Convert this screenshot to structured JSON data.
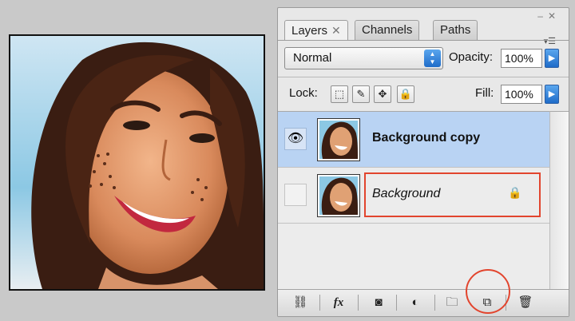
{
  "photo": {
    "alt": ""
  },
  "panel": {
    "tabs": [
      {
        "label": "Layers",
        "close": "✕"
      },
      {
        "label": "Channels"
      },
      {
        "label": "Paths"
      }
    ],
    "menu_icon": "panel-menu-icon",
    "blend_mode": "Normal",
    "opacity_label": "Opacity:",
    "opacity_value": "100%",
    "lock_label": "Lock:",
    "fill_label": "Fill:",
    "fill_value": "100%"
  },
  "layers": [
    {
      "name": "Background copy",
      "visible": true,
      "selected": true
    },
    {
      "name": "Background",
      "visible": false,
      "selected": false,
      "locked": true
    }
  ],
  "bottom_bar": {
    "buttons": [
      "link-icon",
      "fx-icon",
      "mask-icon",
      "adjustment-icon",
      "folder-icon",
      "new-layer-icon",
      "trash-icon"
    ],
    "fx_label": "fx"
  },
  "colors": {
    "selection": "#b9d3f3",
    "highlight": "#e2452e",
    "accent_blue": "#1f6cc9"
  }
}
